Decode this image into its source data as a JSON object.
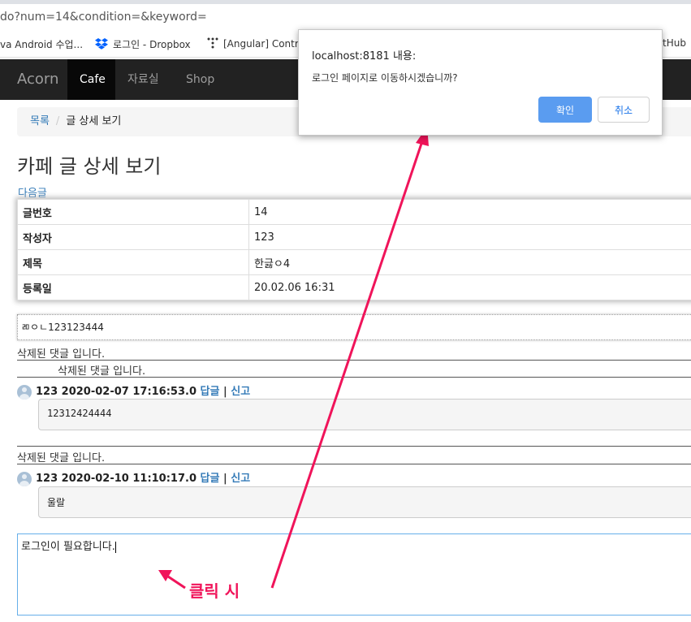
{
  "browser": {
    "url_fragment": "do?num=14&condition=&keyword=",
    "bookmarks": [
      "va Android 수업...",
      "로그인 - Dropbox",
      "[Angular] Contro",
      "tHub"
    ]
  },
  "navbar": {
    "brand": "Acorn",
    "items": [
      "Cafe",
      "자료실",
      "Shop"
    ],
    "active": "Cafe"
  },
  "breadcrumb": {
    "list_link": "목록",
    "separator": "/",
    "current": "글 상세 보기"
  },
  "page_title": "카페 글 상세 보기",
  "next_link": "다음글",
  "info_table": [
    {
      "label": "글번호",
      "value": "14"
    },
    {
      "label": "작성자",
      "value": "123"
    },
    {
      "label": "제목",
      "value": "한긇ㅇ4"
    },
    {
      "label": "등록일",
      "value": "20.02.06 16:31"
    }
  ],
  "post_content": "ㄻㅇㄴ123123444",
  "comments": {
    "deleted_text": "삭제된 댓글 입니다.",
    "items": [
      {
        "writer": "123",
        "date": "2020-02-07 17:16:53.0",
        "reply_label": "답글",
        "separator": "|",
        "report_label": "신고",
        "content": "12312424444"
      },
      {
        "writer": "123",
        "date": "2020-02-10 11:10:17.0",
        "reply_label": "답글",
        "separator": "|",
        "report_label": "신고",
        "content": "울랄"
      }
    ]
  },
  "reply_textarea": {
    "value": "로그인이 필요합니다."
  },
  "annotation": "클릭 시",
  "dialog": {
    "title": "localhost:8181 내용:",
    "message": "로그인 페이지로 이동하시겠습니까?",
    "ok_label": "확인",
    "cancel_label": "취소"
  },
  "colors": {
    "navbar_bg": "#222222",
    "link": "#337ab7",
    "annotation": "#f0145a",
    "ok_button": "#5a9cf0"
  }
}
